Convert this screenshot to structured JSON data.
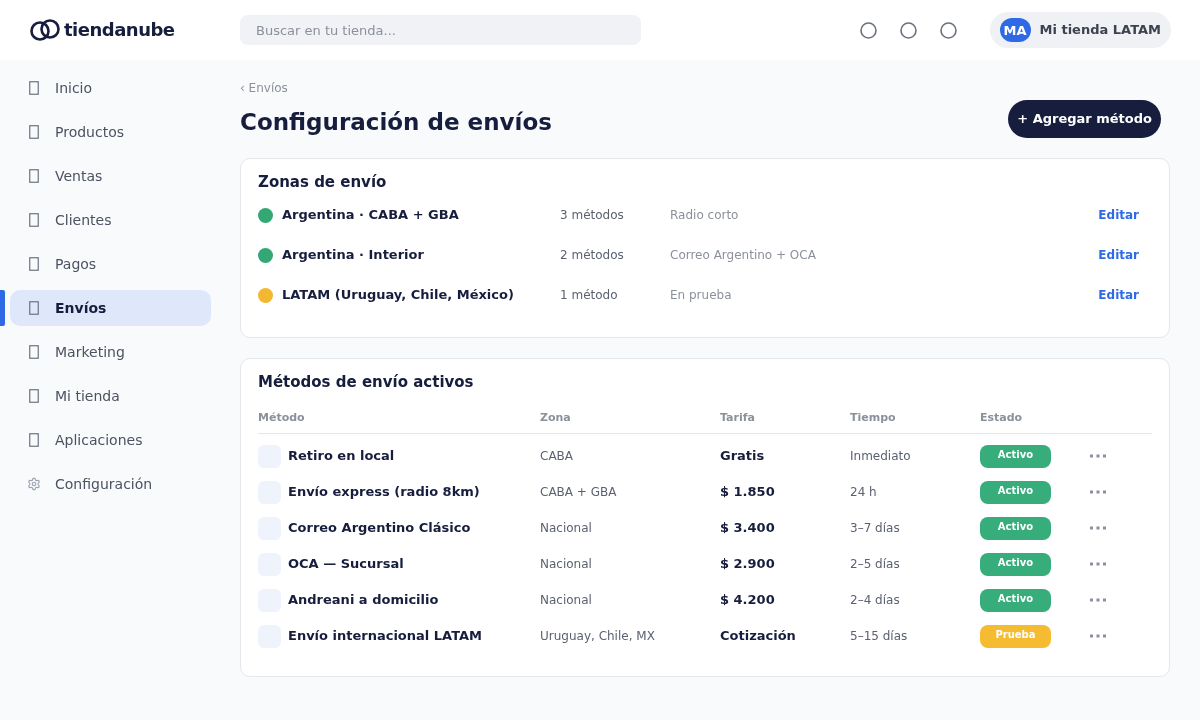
{
  "header": {
    "logo": {
      "text": "tiendanube"
    },
    "search": {
      "placeholder": "Buscar en tu tienda..."
    },
    "store": {
      "initials": "MA",
      "name": "Mi tienda LATAM"
    }
  },
  "sidebar": {
    "items": [
      {
        "label": "Inicio",
        "kind": "page",
        "selected": false
      },
      {
        "label": "Productos",
        "kind": "page",
        "selected": false
      },
      {
        "label": "Ventas",
        "kind": "page",
        "selected": false
      },
      {
        "label": "Clientes",
        "kind": "page",
        "selected": false
      },
      {
        "label": "Pagos",
        "kind": "page",
        "selected": false
      },
      {
        "label": "Envíos",
        "kind": "page",
        "selected": true
      },
      {
        "label": "Marketing",
        "kind": "page",
        "selected": false
      },
      {
        "label": "Mi tienda",
        "kind": "page",
        "selected": false
      },
      {
        "label": "Aplicaciones",
        "kind": "page",
        "selected": false
      },
      {
        "label": "Configuración",
        "kind": "settings",
        "selected": false
      }
    ]
  },
  "page": {
    "breadcrumb": "‹ Envíos",
    "title": "Configuración de envíos",
    "primary_button": "+ Agregar método"
  },
  "zones": {
    "title": "Zonas de envío",
    "items": [
      {
        "name": "Argentina · CABA + GBA",
        "methods": "3 métodos",
        "note": "Radio corto",
        "action": "Editar",
        "color": "#34a874"
      },
      {
        "name": "Argentina · Interior",
        "methods": "2 métodos",
        "note": "Correo Argentino + OCA",
        "action": "Editar",
        "color": "#34a874"
      },
      {
        "name": "LATAM (Uruguay, Chile, México)",
        "methods": "1 método",
        "note": "En prueba",
        "action": "Editar",
        "color": "#f4b731"
      }
    ]
  },
  "methods_table": {
    "title": "Métodos de envío activos",
    "columns": [
      "Método",
      "Zona",
      "Tarifa",
      "Tiempo",
      "Estado"
    ],
    "rows": [
      {
        "method": "Retiro en local",
        "zone": "CABA",
        "rate": "Gratis",
        "time": "Inmediato",
        "status": {
          "label": "Activo",
          "color": "#36ad7a"
        }
      },
      {
        "method": "Envío express (radio 8km)",
        "zone": "CABA + GBA",
        "rate": "$ 1.850",
        "time": "24 h",
        "status": {
          "label": "Activo",
          "color": "#36ad7a"
        }
      },
      {
        "method": "Correo Argentino Clásico",
        "zone": "Nacional",
        "rate": "$ 3.400",
        "time": "3–7 días",
        "status": {
          "label": "Activo",
          "color": "#36ad7a"
        }
      },
      {
        "method": "OCA — Sucursal",
        "zone": "Nacional",
        "rate": "$ 2.900",
        "time": "2–5 días",
        "status": {
          "label": "Activo",
          "color": "#36ad7a"
        }
      },
      {
        "method": "Andreani a domicilio",
        "zone": "Nacional",
        "rate": "$ 4.200",
        "time": "2–4 días",
        "status": {
          "label": "Activo",
          "color": "#36ad7a"
        }
      },
      {
        "method": "Envío internacional LATAM",
        "zone": "Uruguay, Chile, MX",
        "rate": "Cotización",
        "time": "5–15 días",
        "status": {
          "label": "Prueba",
          "color": "#f5bc32"
        }
      }
    ]
  }
}
